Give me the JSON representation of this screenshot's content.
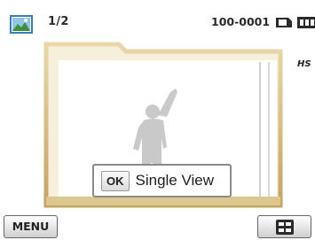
{
  "status_bar": {
    "mode_icon": "photo-icon",
    "counter": "1/2",
    "file_number": "100-0001",
    "memory_icon": "memory-card-icon",
    "battery_icon": "battery-full-icon"
  },
  "hs_badge": "HS",
  "single_view": {
    "ok_label": "OK",
    "label": "Single View"
  },
  "bottom_bar": {
    "menu_label": "MENU",
    "thumbnail_icon": "thumbnail-view-icon"
  },
  "colors": {
    "frame_gold": "#c9ad6a",
    "frame_fill": "#f4ecd7",
    "silhouette": "#c8c8c8"
  }
}
